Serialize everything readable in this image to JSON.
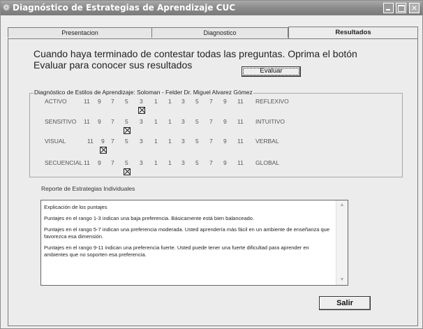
{
  "window": {
    "title": "Diagnóstico de Estrategias de Aprendizaje  CUC",
    "minimize": "",
    "maximize": "",
    "close": "×"
  },
  "tabs": [
    {
      "label": "Presentacion"
    },
    {
      "label": "Diagnostico"
    },
    {
      "label": "Resultados"
    }
  ],
  "instructions": "Cuando haya terminado de contestar todas las preguntas. Oprima el botón Evaluar para conocer sus resultados",
  "evaluate_button": "Evaluar",
  "styles_group": {
    "label": "Diagnóstico de Estilos de Aprendizaje: Soloman - Felder  Dr. Miguel Alvarez Gómez",
    "scale": [
      "11",
      "9",
      "7",
      "5",
      "3",
      "1",
      "1",
      "3",
      "5",
      "7",
      "9",
      "11"
    ],
    "rows": [
      {
        "left": "ACTIVO",
        "right": "REFLEXIVO",
        "selected": "3"
      },
      {
        "left": "SENSITIVO",
        "right": "INTUITIVO",
        "selected": "5"
      },
      {
        "left": "VISUAL",
        "right": "VERBAL",
        "selected": "9"
      },
      {
        "left": "SECUENCIAL",
        "right": "GLOBAL",
        "selected": "5"
      }
    ]
  },
  "report_label": "Reporte de Estrategias Individuales",
  "report_text": [
    "Explicación de los puntajes",
    "Puntajes en el rango 1-3 indican  una baja preferencia. Básicamente está bien balanceado.",
    "Puntajes en el rango 5-7 indican  una preferencia moderada. Usted aprendería más fácil en un ambiente de enseñanza que favorezca esa dimensión.",
    "Puntajes en el rango 9-11 indican  una preferencia fuerte. Usted puede tener una fuerte dificultad para aprender en ambientes que no soporten esa preferencia."
  ],
  "exit_button": "Salir"
}
